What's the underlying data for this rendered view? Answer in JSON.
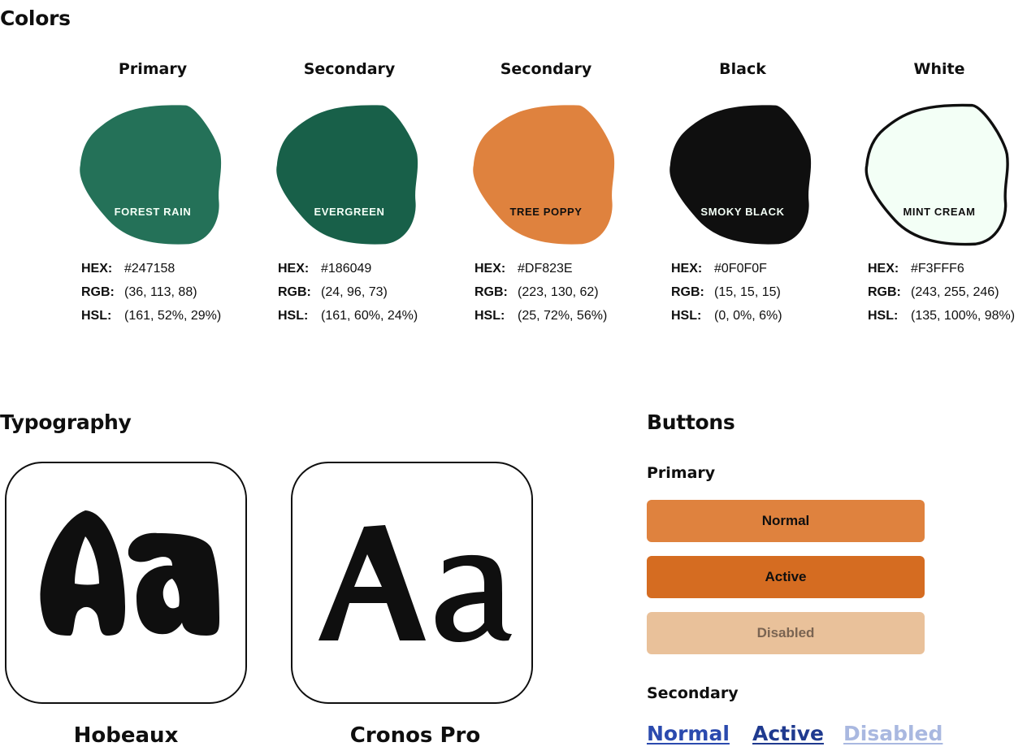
{
  "colors": {
    "title": "Colors",
    "swatches": [
      {
        "label": "Primary",
        "name": "FOREST RAIN",
        "fill": "#247158",
        "stroke": "none",
        "text_color": "#F3FFF6",
        "hex": "#247158",
        "rgb": "(36, 113, 88)",
        "hsl": "(161, 52%, 29%)"
      },
      {
        "label": "Secondary",
        "name": "EVERGREEN",
        "fill": "#186049",
        "stroke": "none",
        "text_color": "#F3FFF6",
        "hex": "#186049",
        "rgb": "(24, 96, 73)",
        "hsl": "(161, 60%, 24%)"
      },
      {
        "label": "Secondary",
        "name": "TREE POPPY",
        "fill": "#DF823E",
        "stroke": "none",
        "text_color": "#0F0F0F",
        "hex": "#DF823E",
        "rgb": "(223, 130, 62)",
        "hsl": "(25, 72%, 56%)"
      },
      {
        "label": "Black",
        "name": "SMOKY BLACK",
        "fill": "#0F0F0F",
        "stroke": "none",
        "text_color": "#F3FFF6",
        "hex": "#0F0F0F",
        "rgb": "(15, 15, 15)",
        "hsl": "(0, 0%, 6%)"
      },
      {
        "label": "White",
        "name": "MINT CREAM",
        "fill": "#F3FFF6",
        "stroke": "#0F0F0F",
        "text_color": "#0F0F0F",
        "hex": "#F3FFF6",
        "rgb": "(243, 255, 246)",
        "hsl": "(135, 100%, 98%)"
      }
    ],
    "hex_key": "HEX:",
    "rgb_key": "RGB:",
    "hsl_key": "HSL:"
  },
  "typography": {
    "title": "Typography",
    "fonts": [
      {
        "name": "Hobeaux",
        "sample": "Aa"
      },
      {
        "name": "Cronos Pro",
        "sample": "Aa"
      }
    ]
  },
  "buttons": {
    "title": "Buttons",
    "primary": {
      "label": "Primary",
      "normal": "Normal",
      "active": "Active",
      "disabled": "Disabled"
    },
    "secondary": {
      "label": "Secondary",
      "normal": "Normal",
      "active": "Active",
      "disabled": "Disabled"
    }
  },
  "theme": {
    "primary_normal_bg": "#DF823E",
    "primary_active_bg": "#D56C21",
    "primary_disabled_bg": "#E9C19A",
    "primary_disabled_text": "#7A6452",
    "link_normal": "#2B4AAE",
    "link_active": "#1F3A8F",
    "link_disabled": "#A9B8E0"
  }
}
